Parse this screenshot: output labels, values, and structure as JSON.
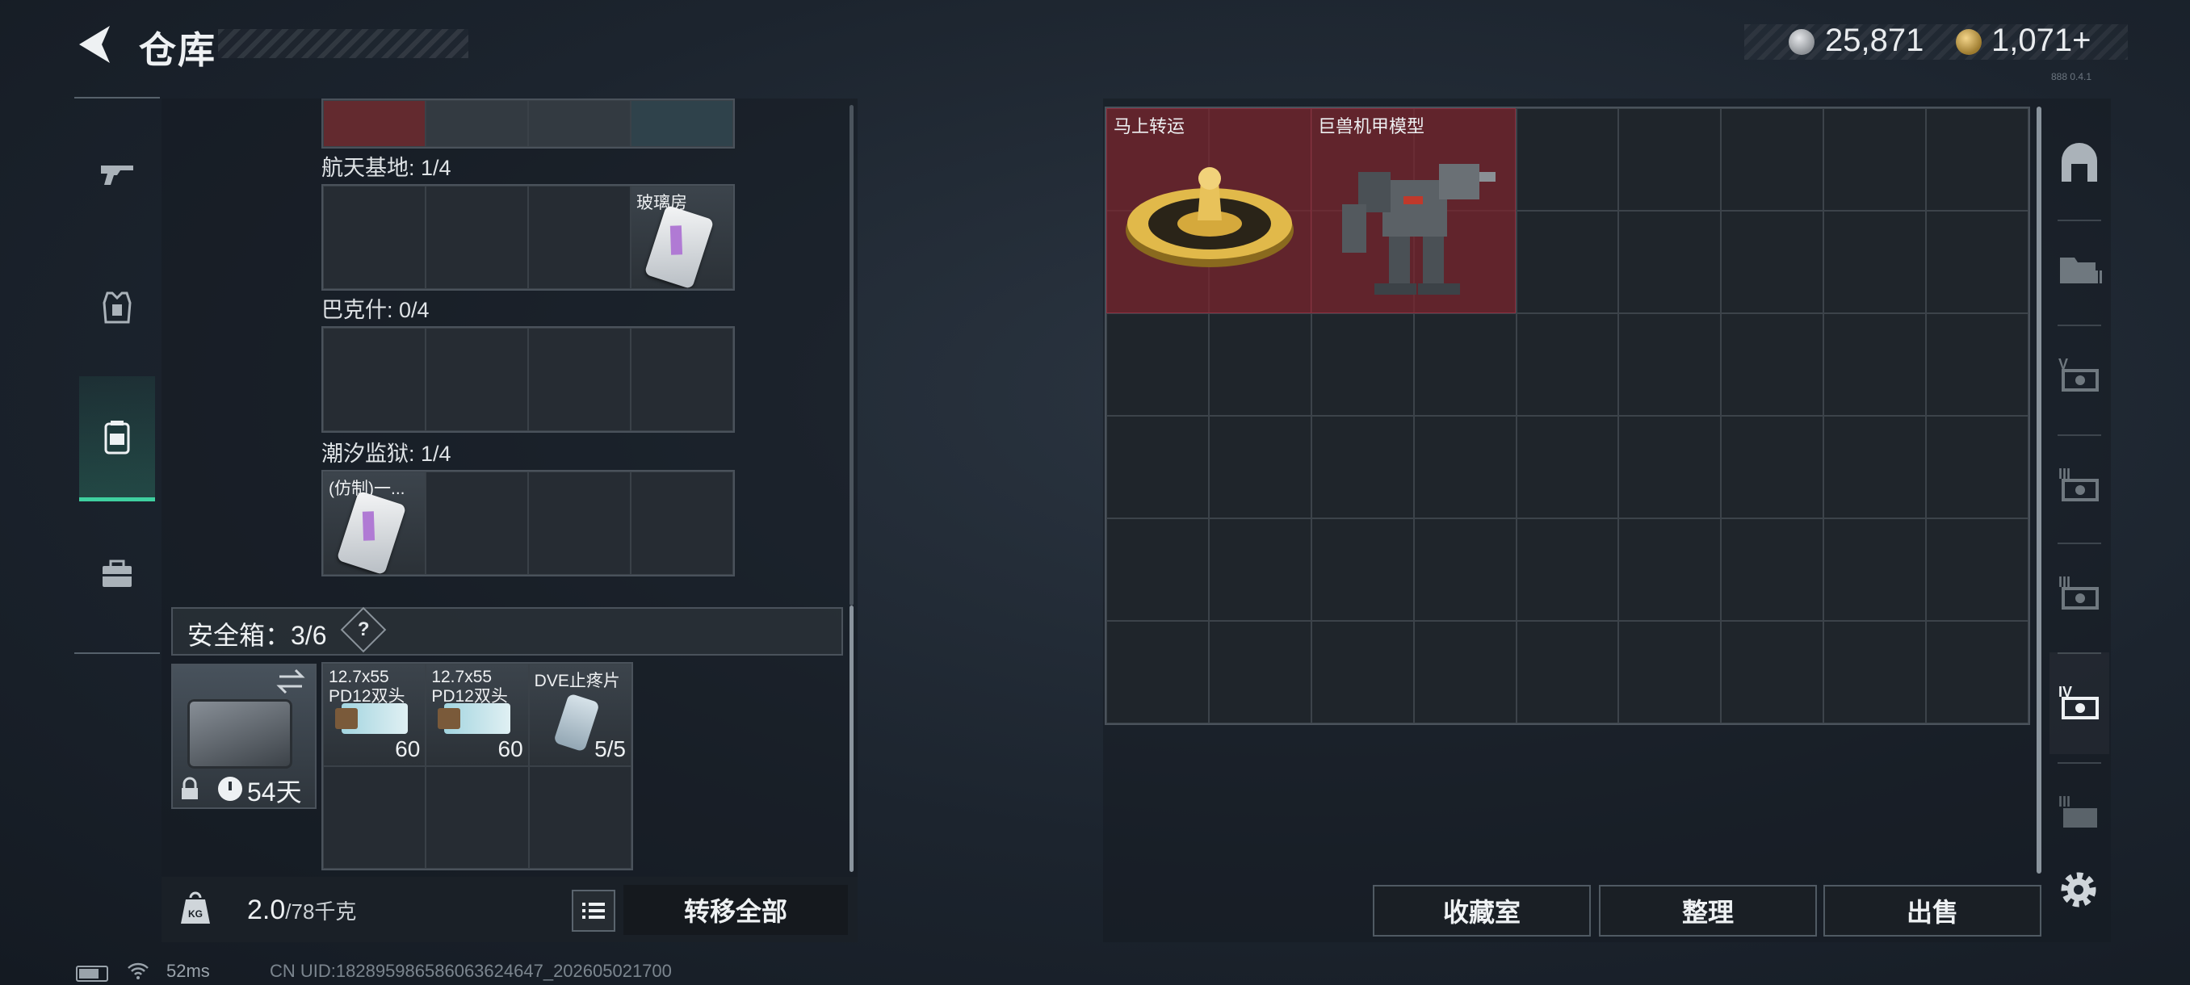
{
  "header": {
    "title": "仓库",
    "silver_amount": "25,871",
    "gold_amount": "1,071+",
    "version": "888 0.4.1"
  },
  "left_nav": {
    "items": [
      {
        "name": "weapon",
        "icon": "gun-icon"
      },
      {
        "name": "armor",
        "icon": "vest-icon"
      },
      {
        "name": "backpack",
        "icon": "backpack-icon",
        "active": true
      },
      {
        "name": "case",
        "icon": "toolbox-icon"
      }
    ]
  },
  "container": {
    "sections": [
      {
        "label": "航天基地: 1/4",
        "items": [
          {
            "slot": 3,
            "name": "玻璃房"
          }
        ]
      },
      {
        "label": "巴克什: 0/4",
        "items": []
      },
      {
        "label": "潮汐监狱: 1/4",
        "items": [
          {
            "slot": 0,
            "name": "(仿制)一..."
          }
        ]
      }
    ]
  },
  "safebox": {
    "label": "安全箱：3/6",
    "help": "?",
    "days": "54天",
    "items": [
      {
        "name": "12.7x55 PD12双头",
        "count": "60"
      },
      {
        "name": "12.7x55 PD12双头",
        "count": "60"
      },
      {
        "name": "DVE止疼片",
        "count": "5/5"
      }
    ]
  },
  "weight": {
    "current": "2.0",
    "max": "/78千克"
  },
  "transfer_all": "转移全部",
  "status": {
    "ping": "52ms",
    "uid": "CN UID:18289598658606362464​7_202605021700"
  },
  "stash": {
    "items": [
      {
        "name": "马上转运"
      },
      {
        "name": "巨兽机甲模型"
      }
    ]
  },
  "right_nav": {
    "items": [
      {
        "icon": "vault-icon"
      },
      {
        "icon": "folder-icon"
      },
      {
        "icon": "crate-v-icon"
      },
      {
        "icon": "crate-iii-icon"
      },
      {
        "icon": "crate-iii-icon"
      },
      {
        "icon": "crate-iv-icon",
        "active": true
      },
      {
        "icon": "crate-iii-icon"
      }
    ]
  },
  "actions": {
    "collection": "收藏室",
    "organize": "整理",
    "sell": "出售"
  },
  "colors": {
    "accent": "#3fd0a0",
    "item_red": "#782e3a",
    "panel": "#1c242e"
  }
}
